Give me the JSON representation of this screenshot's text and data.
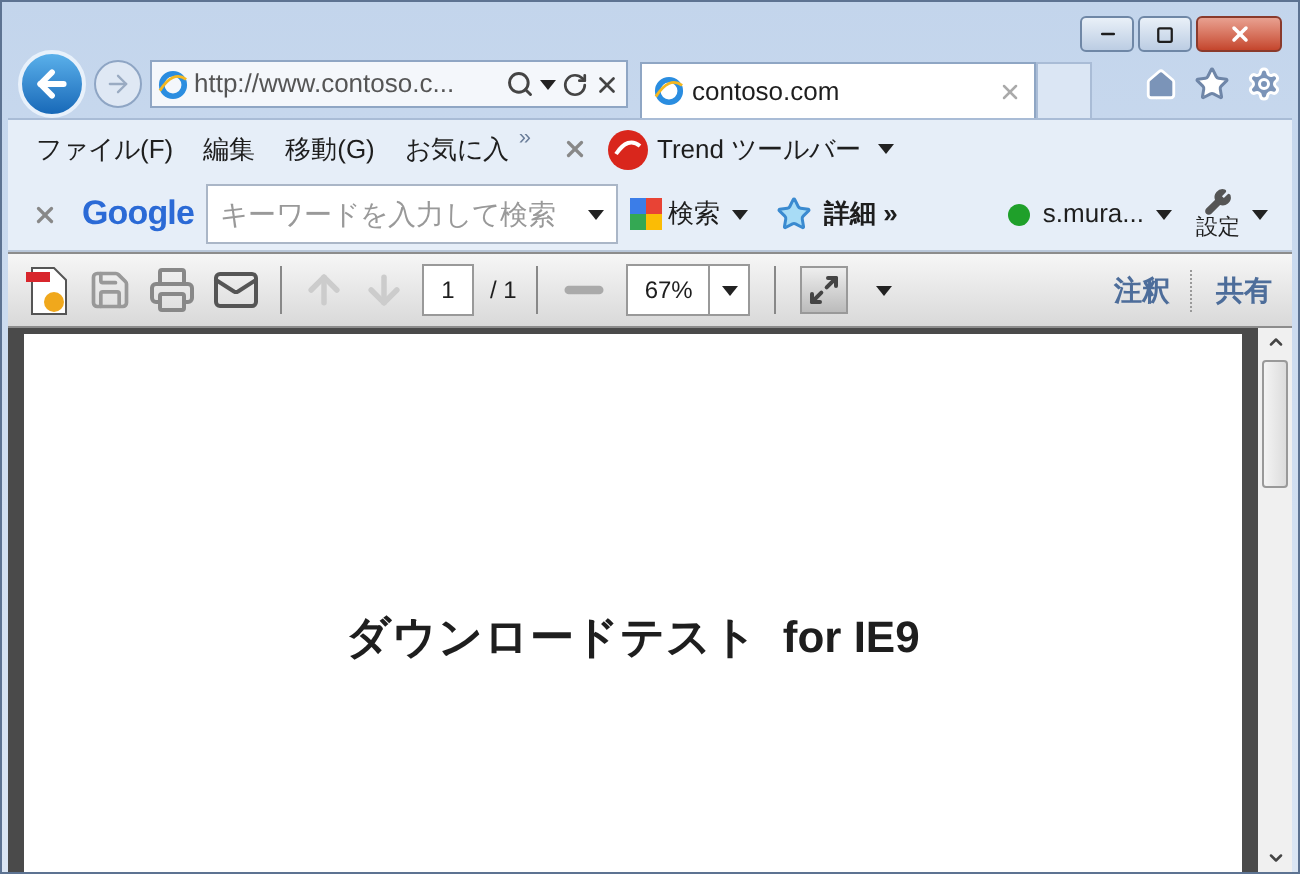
{
  "address_bar": {
    "value": "http://www.contoso.c..."
  },
  "tabs": [
    {
      "label": "contoso.com",
      "selected": true
    }
  ],
  "menu_bar": {
    "items": [
      "ファイル(F)",
      "編集",
      "移動(G)",
      "お気に入"
    ],
    "overflow": "»"
  },
  "trend_toolbar": {
    "label": "Trend ツールバー"
  },
  "google_toolbar": {
    "logo": "Google",
    "search": {
      "placeholder": "キーワードを入力して検索"
    },
    "search_button": "検索",
    "more": "詳細 »",
    "account": "s.mura...",
    "settings": "設定"
  },
  "pdf_toolbar": {
    "page": "1",
    "page_total": "/ 1",
    "zoom": "67%",
    "annotate": "注釈",
    "share": "共有"
  },
  "document": {
    "heading": "ダウンロードテスト  for IE9"
  }
}
